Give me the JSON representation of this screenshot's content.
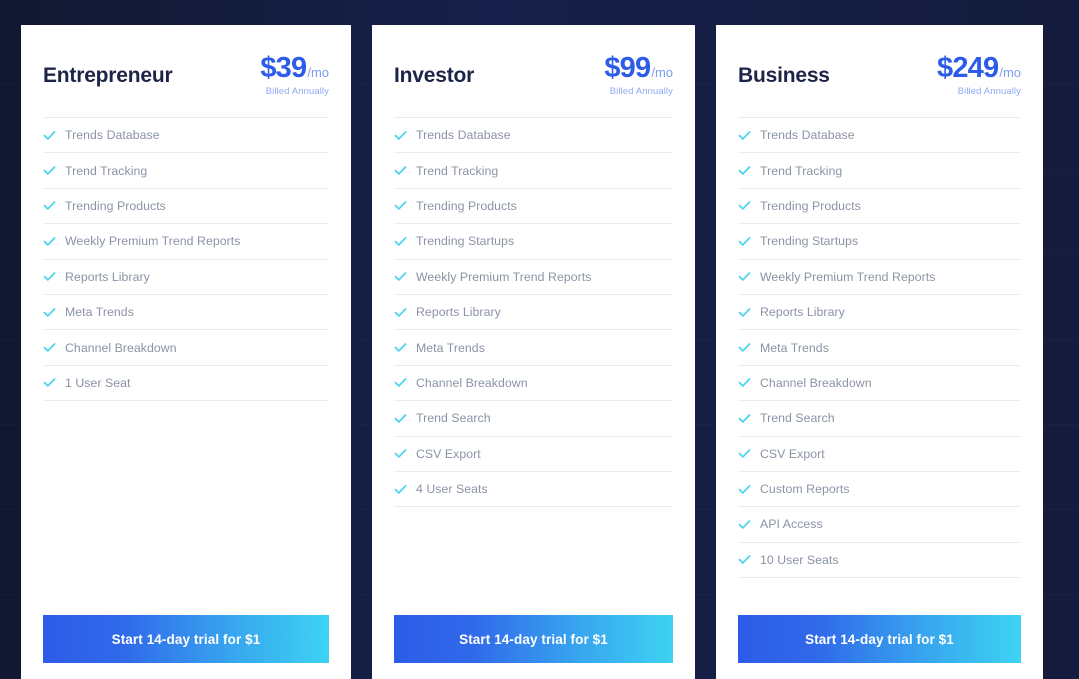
{
  "background": {
    "color": "#141B3C"
  },
  "theme": {
    "accent_blue": "#2D5CE8",
    "accent_cyan": "#3DD3F2",
    "check_color": "#4AD5EE",
    "feature_text": "#8A93A5",
    "title_color": "#1D2448",
    "billing_note_color": "#8FAAF3"
  },
  "plans": [
    {
      "name": "Entrepreneur",
      "price": "$39",
      "period": "/mo",
      "billing_note": "Billed Annually",
      "cta_label": "Start 14-day trial for $1",
      "features": [
        "Trends Database",
        "Trend Tracking",
        "Trending Products",
        "Weekly Premium Trend Reports",
        "Reports Library",
        "Meta Trends",
        "Channel Breakdown",
        "1 User Seat"
      ]
    },
    {
      "name": "Investor",
      "price": "$99",
      "period": "/mo",
      "billing_note": "Billed Annually",
      "cta_label": "Start 14-day trial for $1",
      "features": [
        "Trends Database",
        "Trend Tracking",
        "Trending Products",
        "Trending Startups",
        "Weekly Premium Trend Reports",
        "Reports Library",
        "Meta Trends",
        "Channel Breakdown",
        "Trend Search",
        "CSV Export",
        "4 User Seats"
      ]
    },
    {
      "name": "Business",
      "price": "$249",
      "period": "/mo",
      "billing_note": "Billed Annually",
      "cta_label": "Start 14-day trial for $1",
      "features": [
        "Trends Database",
        "Trend Tracking",
        "Trending Products",
        "Trending Startups",
        "Weekly Premium Trend Reports",
        "Reports Library",
        "Meta Trends",
        "Channel Breakdown",
        "Trend Search",
        "CSV Export",
        "Custom Reports",
        "API Access",
        "10 User Seats"
      ]
    }
  ]
}
